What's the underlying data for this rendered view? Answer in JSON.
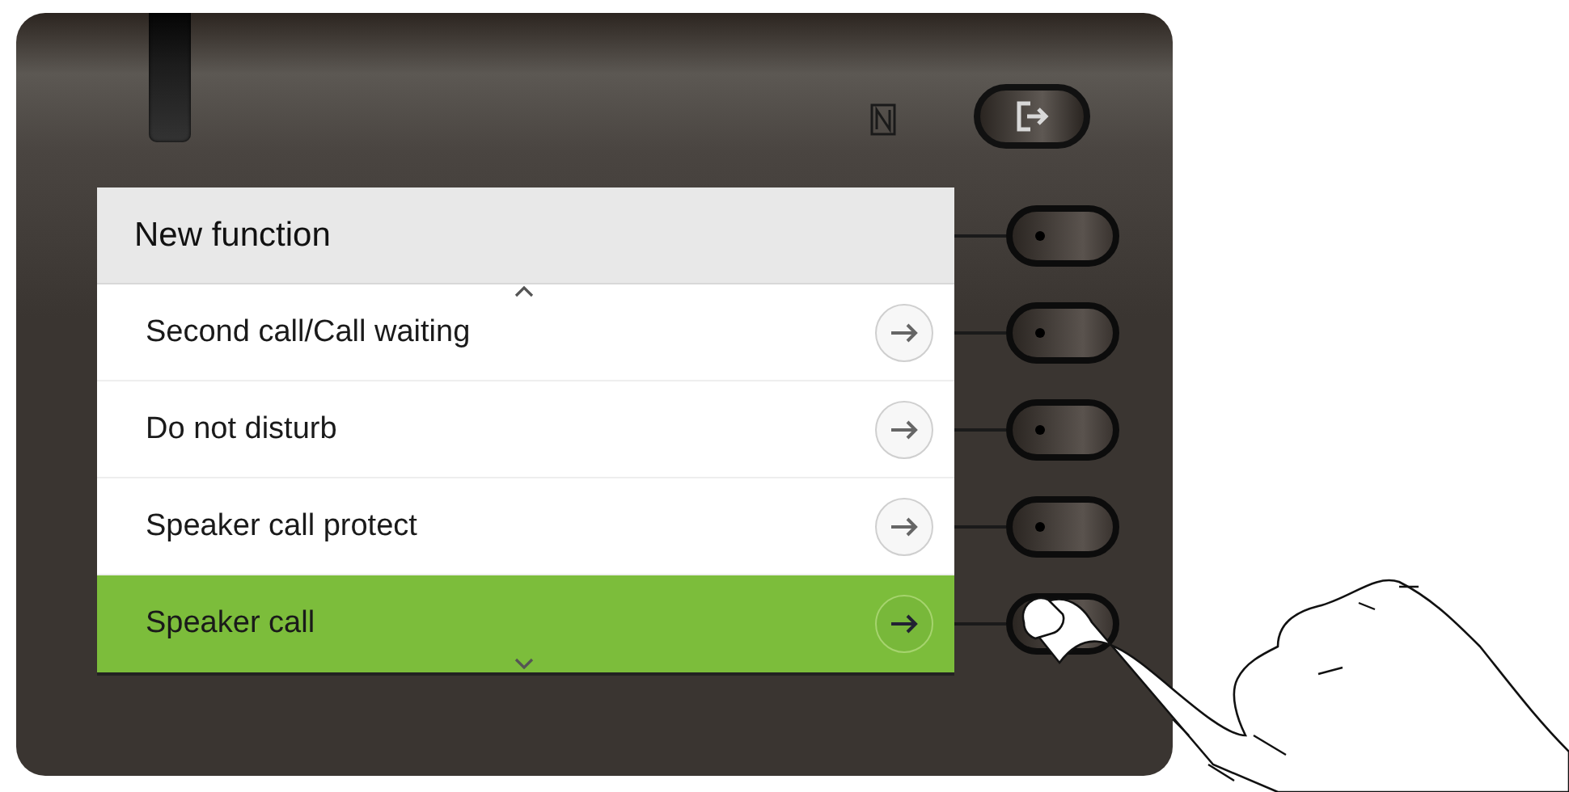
{
  "screen": {
    "title": "New function",
    "items": [
      {
        "label": "Second call/Call waiting",
        "selected": false
      },
      {
        "label": "Do not disturb",
        "selected": false
      },
      {
        "label": "Speaker call protect",
        "selected": false
      },
      {
        "label": "Speaker call",
        "selected": true
      }
    ]
  }
}
